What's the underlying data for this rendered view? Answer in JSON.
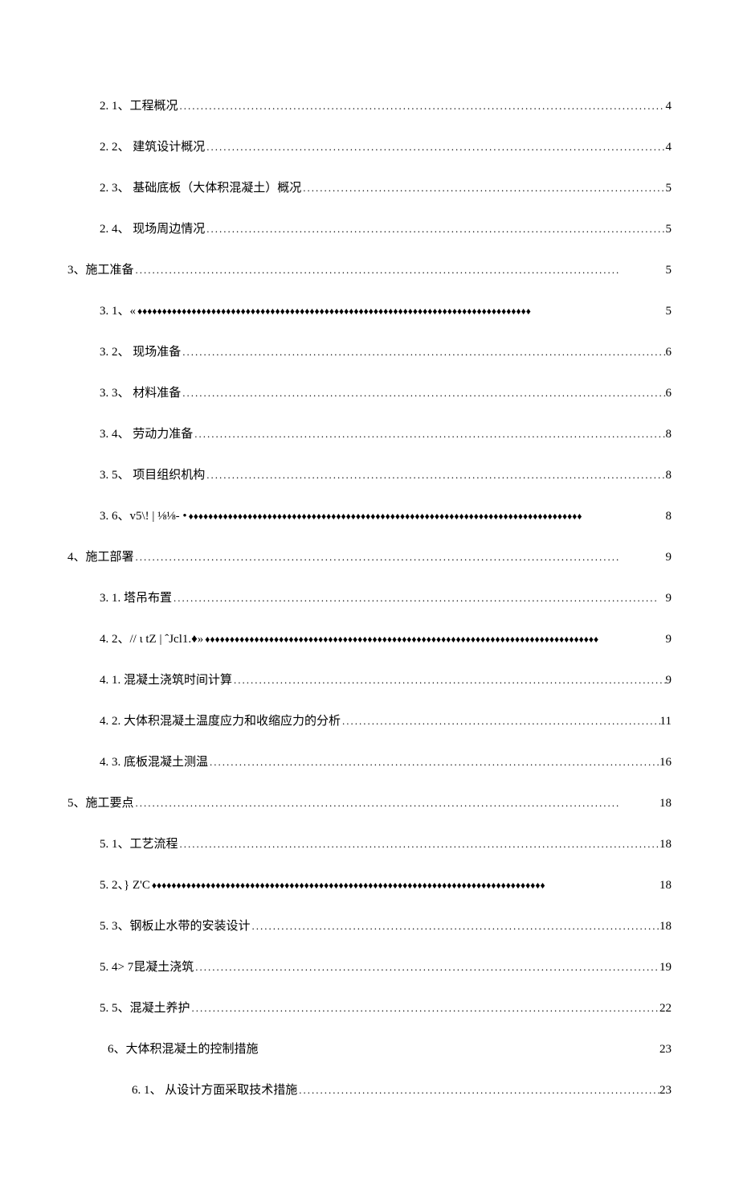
{
  "toc": [
    {
      "indent": 2,
      "label": "2.  1、工程概况 ",
      "leader": "dots",
      "page": "4"
    },
    {
      "indent": 2,
      "label": "2. 2、  建筑设计概况 ",
      "leader": "dots",
      "page": "4"
    },
    {
      "indent": 2,
      "label": "2. 3、  基础底板（大体积混凝土）概况 ",
      "leader": "dots",
      "page": "5"
    },
    {
      "indent": 2,
      "label": "2. 4、  现场周边情况 ",
      "leader": "dots",
      "page": "5"
    },
    {
      "indent": 1,
      "label": "3、施工准备",
      "leader": "dots",
      "page": "5"
    },
    {
      "indent": 2,
      "label": "3.  1、«",
      "leader": "diamonds",
      "page": "5"
    },
    {
      "indent": 2,
      "label": "3. 2、  现场准备 ",
      "leader": "dots",
      "page": "6"
    },
    {
      "indent": 2,
      "label": "3. 3、  材料准备 ",
      "leader": "dots",
      "page": "6"
    },
    {
      "indent": 2,
      "label": "3. 4、  劳动力准备 ",
      "leader": "dots",
      "page": "8"
    },
    {
      "indent": 2,
      "label": "3. 5、  项目组织机构 ",
      "leader": "dots",
      "page": "8"
    },
    {
      "indent": 2,
      "label": "3.  6、v5\\! | ⅛⅛- •",
      "leader": "diamonds",
      "page": "8"
    },
    {
      "indent": 1,
      "label": "4、施工部署",
      "leader": "dots",
      "page": "9"
    },
    {
      "indent": 2,
      "label": "3. 1.  塔吊布置",
      "leader": "dots",
      "page": "9"
    },
    {
      "indent": 2,
      "label": "4.  2、// ι tZ | ˆJcl1.♦»",
      "leader": "diamonds",
      "page": "9"
    },
    {
      "indent": 2,
      "label": "4. 1.  混凝土浇筑时间计算 ",
      "leader": "dots",
      "page": "9"
    },
    {
      "indent": 2,
      "label": "4. 2.  大体积混凝土温度应力和收缩应力的分析 ",
      "leader": "dots",
      "page": "11"
    },
    {
      "indent": 2,
      "label": "4. 3.  底板混凝土测温 ",
      "leader": "dots",
      "page": "16"
    },
    {
      "indent": 1,
      "label": "5、施工要点",
      "leader": "dots",
      "page": "18"
    },
    {
      "indent": 2,
      "label": "5.  1、工艺流程",
      "leader": "dots",
      "page": "18"
    },
    {
      "indent": 2,
      "label": "5.  2、} Z'C   ",
      "leader": "diamonds",
      "page": "18"
    },
    {
      "indent": 2,
      "label": "5. 3、钢板止水带的安装设计 ",
      "leader": "dots",
      "page": "18"
    },
    {
      "indent": 2,
      "label": "5. 4>  7昆凝土浇筑",
      "leader": "dots",
      "page": "19"
    },
    {
      "indent": 2,
      "label": "5. 5、混凝土养护 ",
      "leader": "dots",
      "page": "22"
    },
    {
      "indent": 3,
      "label": "6、大体积混凝土的控制措施",
      "leader": "none",
      "page": "23"
    },
    {
      "indent": 4,
      "label": "6. 1、  从设计方面采取技术措施 ",
      "leader": "dots",
      "page": "23"
    }
  ],
  "dotFill": "...................................................................................................................",
  "diamondFill": "♦♦♦♦♦♦♦♦♦♦♦♦♦♦♦♦♦♦♦♦♦♦♦♦♦♦♦♦♦♦♦♦♦♦♦♦♦♦♦♦♦♦♦♦♦♦♦♦♦♦♦♦♦♦♦♦♦♦♦♦♦♦♦♦♦♦♦♦♦♦♦♦♦♦♦♦♦♦♦♦"
}
